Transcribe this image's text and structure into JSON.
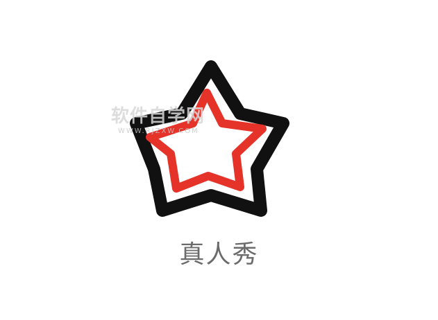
{
  "logo": {
    "icon": "star-outline-icon",
    "outer_color": "#111111",
    "inner_color": "#e53329",
    "caption": "真人秀"
  },
  "watermark": {
    "main_text": "软件自学网",
    "sub_text": "WWW.RJZXW.COM"
  }
}
